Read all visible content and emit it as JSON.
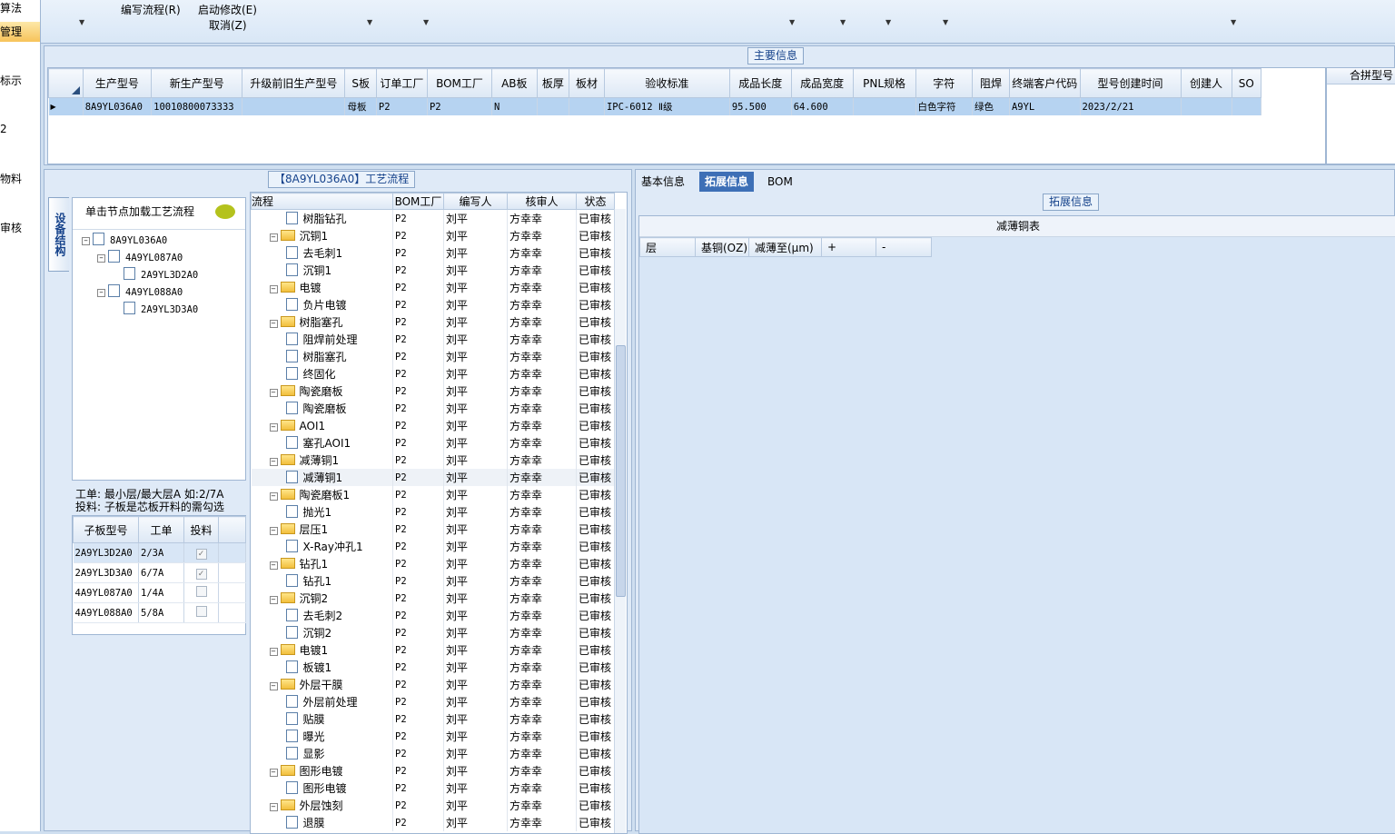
{
  "left_nav": [
    {
      "label": "算法",
      "selected": false
    },
    {
      "label": "管理",
      "selected": true
    },
    {
      "label": "标示",
      "selected": false
    },
    {
      "label": "2",
      "selected": false
    },
    {
      "label": "物料",
      "selected": false
    },
    {
      "label": "审核",
      "selected": false
    }
  ],
  "ribbon": {
    "edit_flow": "编写流程(R)",
    "start_modify": "启动修改(E)",
    "cancel": "取消(Z)"
  },
  "main_info": {
    "section_title": "主要信息",
    "columns": [
      "生产型号",
      "新生产型号",
      "升级前旧生产型号",
      "S板",
      "订单工厂",
      "BOM工厂",
      "AB板",
      "板厚",
      "板材",
      "验收标准",
      "成品长度",
      "成品宽度",
      "PNL规格",
      "字符",
      "阻焊",
      "终端客户代码",
      "型号创建时间",
      "创建人",
      "SO"
    ],
    "rows": [
      [
        "8A9YL036A0",
        "10010800073333",
        "",
        "母板",
        "P2",
        "P2",
        "N",
        "",
        "",
        "IPC-6012 Ⅱ级",
        "95.500",
        "64.600",
        "",
        "白色字符",
        "绿色",
        "A9YL",
        "2023/2/21",
        "",
        ""
      ]
    ],
    "merge_title": "合拼型号"
  },
  "structure": {
    "vertical_tab": "设备结构",
    "hint": "单击节点加载工艺流程",
    "tree": [
      {
        "label": "8A9YL036A0",
        "level": 0
      },
      {
        "label": "4A9YL087A0",
        "level": 1
      },
      {
        "label": "2A9YL3D2A0",
        "level": 2
      },
      {
        "label": "4A9YL088A0",
        "level": 1
      },
      {
        "label": "2A9YL3D3A0",
        "level": 2
      }
    ],
    "note1": "工单: 最小层/最大层A 如:2/7A",
    "note2": "投料: 子板是芯板开料的需勾选",
    "sub_columns": [
      "子板型号",
      "工单",
      "投料"
    ],
    "sub_rows": [
      {
        "model": "2A9YL3D2A0",
        "order": "2/3A",
        "feed": true
      },
      {
        "model": "2A9YL3D3A0",
        "order": "6/7A",
        "feed": true
      },
      {
        "model": "4A9YL087A0",
        "order": "1/4A",
        "feed": false
      },
      {
        "model": "4A9YL088A0",
        "order": "5/8A",
        "feed": false
      }
    ]
  },
  "process_flow": {
    "title": "【8A9YL036A0】工艺流程",
    "columns": [
      "流程",
      "BOM工厂",
      "编写人",
      "核审人",
      "状态"
    ],
    "rows": [
      {
        "name": "树脂钻孔",
        "type": "file",
        "factory": "P2",
        "writer": "刘平",
        "reviewer": "方幸幸",
        "status": "已审核"
      },
      {
        "name": "沉铜1",
        "type": "folder",
        "factory": "P2",
        "writer": "刘平",
        "reviewer": "方幸幸",
        "status": "已审核"
      },
      {
        "name": "去毛刺1",
        "type": "file",
        "factory": "P2",
        "writer": "刘平",
        "reviewer": "方幸幸",
        "status": "已审核"
      },
      {
        "name": "沉铜1",
        "type": "file",
        "factory": "P2",
        "writer": "刘平",
        "reviewer": "方幸幸",
        "status": "已审核"
      },
      {
        "name": "电镀",
        "type": "folder",
        "factory": "P2",
        "writer": "刘平",
        "reviewer": "方幸幸",
        "status": "已审核"
      },
      {
        "name": "负片电镀",
        "type": "file",
        "factory": "P2",
        "writer": "刘平",
        "reviewer": "方幸幸",
        "status": "已审核"
      },
      {
        "name": "树脂塞孔",
        "type": "folder",
        "factory": "P2",
        "writer": "刘平",
        "reviewer": "方幸幸",
        "status": "已审核"
      },
      {
        "name": "阻焊前处理",
        "type": "file",
        "factory": "P2",
        "writer": "刘平",
        "reviewer": "方幸幸",
        "status": "已审核"
      },
      {
        "name": "树脂塞孔",
        "type": "file",
        "factory": "P2",
        "writer": "刘平",
        "reviewer": "方幸幸",
        "status": "已审核"
      },
      {
        "name": "终固化",
        "type": "file",
        "factory": "P2",
        "writer": "刘平",
        "reviewer": "方幸幸",
        "status": "已审核"
      },
      {
        "name": "陶瓷磨板",
        "type": "folder",
        "factory": "P2",
        "writer": "刘平",
        "reviewer": "方幸幸",
        "status": "已审核"
      },
      {
        "name": "陶瓷磨板",
        "type": "file",
        "factory": "P2",
        "writer": "刘平",
        "reviewer": "方幸幸",
        "status": "已审核"
      },
      {
        "name": "AOI1",
        "type": "folder",
        "factory": "P2",
        "writer": "刘平",
        "reviewer": "方幸幸",
        "status": "已审核"
      },
      {
        "name": "塞孔AOI1",
        "type": "file",
        "factory": "P2",
        "writer": "刘平",
        "reviewer": "方幸幸",
        "status": "已审核"
      },
      {
        "name": "减薄铜1",
        "type": "folder",
        "factory": "P2",
        "writer": "刘平",
        "reviewer": "方幸幸",
        "status": "已审核"
      },
      {
        "name": "减薄铜1",
        "type": "file",
        "factory": "P2",
        "writer": "刘平",
        "reviewer": "方幸幸",
        "status": "已审核",
        "selected": true
      },
      {
        "name": "陶瓷磨板1",
        "type": "folder",
        "factory": "P2",
        "writer": "刘平",
        "reviewer": "方幸幸",
        "status": "已审核"
      },
      {
        "name": "抛光1",
        "type": "file",
        "factory": "P2",
        "writer": "刘平",
        "reviewer": "方幸幸",
        "status": "已审核"
      },
      {
        "name": "层压1",
        "type": "folder",
        "factory": "P2",
        "writer": "刘平",
        "reviewer": "方幸幸",
        "status": "已审核"
      },
      {
        "name": "X-Ray冲孔1",
        "type": "file",
        "factory": "P2",
        "writer": "刘平",
        "reviewer": "方幸幸",
        "status": "已审核"
      },
      {
        "name": "钻孔1",
        "type": "folder",
        "factory": "P2",
        "writer": "刘平",
        "reviewer": "方幸幸",
        "status": "已审核"
      },
      {
        "name": "钻孔1",
        "type": "file",
        "factory": "P2",
        "writer": "刘平",
        "reviewer": "方幸幸",
        "status": "已审核"
      },
      {
        "name": "沉铜2",
        "type": "folder",
        "factory": "P2",
        "writer": "刘平",
        "reviewer": "方幸幸",
        "status": "已审核"
      },
      {
        "name": "去毛刺2",
        "type": "file",
        "factory": "P2",
        "writer": "刘平",
        "reviewer": "方幸幸",
        "status": "已审核"
      },
      {
        "name": "沉铜2",
        "type": "file",
        "factory": "P2",
        "writer": "刘平",
        "reviewer": "方幸幸",
        "status": "已审核"
      },
      {
        "name": "电镀1",
        "type": "folder",
        "factory": "P2",
        "writer": "刘平",
        "reviewer": "方幸幸",
        "status": "已审核"
      },
      {
        "name": "板镀1",
        "type": "file",
        "factory": "P2",
        "writer": "刘平",
        "reviewer": "方幸幸",
        "status": "已审核"
      },
      {
        "name": "外层干膜",
        "type": "folder",
        "factory": "P2",
        "writer": "刘平",
        "reviewer": "方幸幸",
        "status": "已审核"
      },
      {
        "name": "外层前处理",
        "type": "file",
        "factory": "P2",
        "writer": "刘平",
        "reviewer": "方幸幸",
        "status": "已审核"
      },
      {
        "name": "贴膜",
        "type": "file",
        "factory": "P2",
        "writer": "刘平",
        "reviewer": "方幸幸",
        "status": "已审核"
      },
      {
        "name": "曝光",
        "type": "file",
        "factory": "P2",
        "writer": "刘平",
        "reviewer": "方幸幸",
        "status": "已审核"
      },
      {
        "name": "显影",
        "type": "file",
        "factory": "P2",
        "writer": "刘平",
        "reviewer": "方幸幸",
        "status": "已审核"
      },
      {
        "name": "图形电镀",
        "type": "folder",
        "factory": "P2",
        "writer": "刘平",
        "reviewer": "方幸幸",
        "status": "已审核"
      },
      {
        "name": "图形电镀",
        "type": "file",
        "factory": "P2",
        "writer": "刘平",
        "reviewer": "方幸幸",
        "status": "已审核"
      },
      {
        "name": "外层蚀刻",
        "type": "folder",
        "factory": "P2",
        "writer": "刘平",
        "reviewer": "方幸幸",
        "status": "已审核"
      },
      {
        "name": "退膜",
        "type": "file",
        "factory": "P2",
        "writer": "刘平",
        "reviewer": "方幸幸",
        "status": "已审核"
      }
    ]
  },
  "details": {
    "tabs": [
      {
        "label": "基本信息",
        "active": false
      },
      {
        "label": "拓展信息",
        "active": true
      },
      {
        "label": "BOM",
        "active": false
      }
    ],
    "section_title": "拓展信息",
    "table_title": "减薄铜表",
    "columns": [
      "层",
      "基铜(OZ)",
      "减薄至(μm)",
      "+",
      "-"
    ]
  },
  "colors": {
    "accent": "#3d6fb6",
    "selected_row": "#b6d3f1",
    "panel": "#dfeaf7"
  }
}
